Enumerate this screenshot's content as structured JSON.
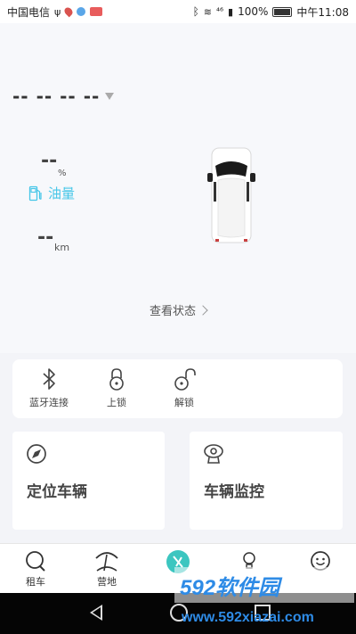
{
  "status_bar": {
    "carrier": "中国电信",
    "signal_text": "⁴⁶",
    "battery_text": "100%",
    "time": "中午11:08"
  },
  "vehicle": {
    "plate": "-- -- -- --",
    "fuel_value": "--",
    "fuel_unit": "%",
    "fuel_label": "油量",
    "mileage_value": "--",
    "mileage_unit": "km",
    "view_status_label": "查看状态"
  },
  "quick_actions": [
    {
      "label": "蓝牙连接",
      "icon": "bluetooth-icon"
    },
    {
      "label": "上锁",
      "icon": "lock-icon"
    },
    {
      "label": "解锁",
      "icon": "unlock-icon"
    }
  ],
  "feature_cards": [
    {
      "title": "定位车辆",
      "icon": "locate-icon"
    },
    {
      "title": "车辆监控",
      "icon": "camera-icon"
    }
  ],
  "bottom_nav": [
    {
      "label": "租车",
      "icon": "search-icon"
    },
    {
      "label": "营地",
      "icon": "camp-icon"
    },
    {
      "label": "",
      "icon": "car-home-icon",
      "active": true
    },
    {
      "label": "",
      "icon": "bulb-icon"
    },
    {
      "label": "",
      "icon": "smile-icon"
    }
  ],
  "watermark": {
    "brand": "592软件园",
    "url": "www.592xiazai.com"
  },
  "colors": {
    "accent": "#3cc6c0",
    "fuel": "#46c6e8",
    "background": "#f3f4f8",
    "watermark": "#2e8be6"
  }
}
